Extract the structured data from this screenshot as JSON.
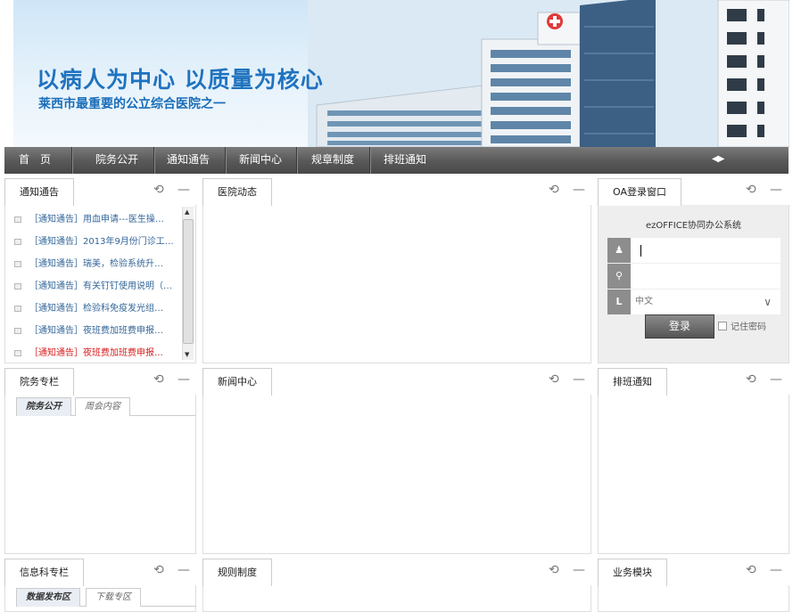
{
  "banner": {
    "slogan": "以病人为中心  以质量为核心",
    "subtitle": "莱西市最重要的公立综合医院之一"
  },
  "nav": {
    "items": [
      "首　页",
      "院务公开",
      "通知通告",
      "新闻中心",
      "规章制度",
      "排班通知"
    ],
    "scroll_arrows": "◀▶"
  },
  "controls": {
    "refresh": "⟲",
    "minimize": "—"
  },
  "panels": {
    "notice": {
      "title": "通知通告",
      "items": [
        {
          "text": "［通知通告］用血申请---医生操…",
          "color": "#336699"
        },
        {
          "text": "［通知通告］2013年9月份门诊工…",
          "color": "#336699"
        },
        {
          "text": "［通知通告］瑞美，检验系统升…",
          "color": "#336699"
        },
        {
          "text": "［通知通告］有关钉钉使用说明（…",
          "color": "#336699"
        },
        {
          "text": "［通知通告］检验科免疫发光组…",
          "color": "#336699"
        },
        {
          "text": "［通知通告］夜班费加班费申报…",
          "color": "#336699"
        },
        {
          "text": "［通知通告］夜班费加班费申报…",
          "color": "#d91c1c"
        }
      ]
    },
    "hospital_news": {
      "title": "医院动态"
    },
    "oa_login": {
      "title": "OA登录窗口",
      "system_name": "ezOFFICE协同办公系统",
      "username": "",
      "password": "",
      "language": "中文",
      "login_button": "登录",
      "remember_label": "记住密码"
    },
    "affairs": {
      "title": "院务专栏",
      "subtabs": [
        "院务公开",
        "周会内容"
      ]
    },
    "news_center": {
      "title": "新闻中心"
    },
    "schedule": {
      "title": "排班通知"
    },
    "info_dept": {
      "title": "信息科专栏",
      "subtabs": [
        "数据发布区",
        "下载专区"
      ]
    },
    "regulations": {
      "title": "规则制度"
    },
    "business": {
      "title": "业务模块"
    }
  },
  "colors": {
    "nav_bg": "#5a5a5a",
    "link": "#336699",
    "alert": "#d91c1c",
    "brand_blue": "#1f73bf"
  }
}
